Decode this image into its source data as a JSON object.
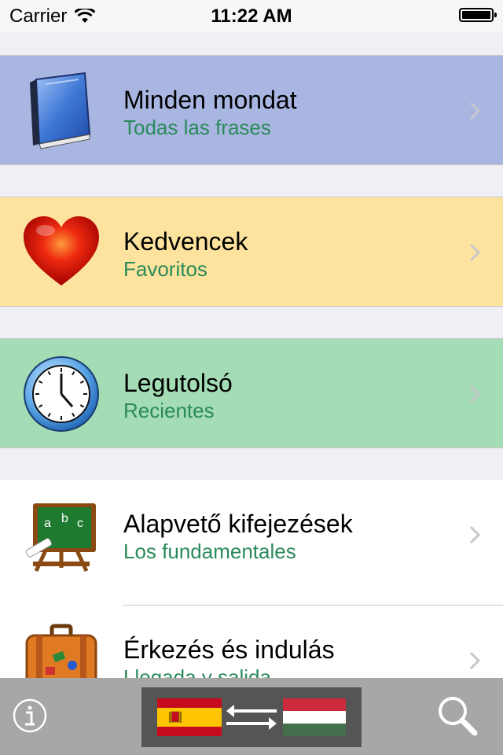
{
  "status_bar": {
    "carrier": "Carrier",
    "time": "11:22 AM"
  },
  "menu": [
    {
      "title": "Minden mondat",
      "subtitle": "Todas las frases",
      "icon": "book-icon",
      "color": "#a9b6e2"
    },
    {
      "title": "Kedvencek",
      "subtitle": "Favoritos",
      "icon": "heart-icon",
      "color": "#fde39d"
    },
    {
      "title": "Legutolsó",
      "subtitle": "Recientes",
      "icon": "clock-icon",
      "color": "#a3dcb5"
    },
    {
      "title": "Alapvető kifejezések",
      "subtitle": "Los fundamentales",
      "icon": "chalkboard-icon",
      "color": "#ffffff"
    },
    {
      "title": "Érkezés és indulás",
      "subtitle": "Llegada y salida",
      "icon": "suitcase-icon",
      "color": "#ffffff"
    }
  ],
  "toolbar": {
    "info_icon": "info-icon",
    "language_switch": {
      "from_flag": "spain-flag-icon",
      "to_flag": "hungary-flag-icon",
      "swap_icon": "swap-arrows-icon"
    },
    "search_icon": "search-icon"
  }
}
